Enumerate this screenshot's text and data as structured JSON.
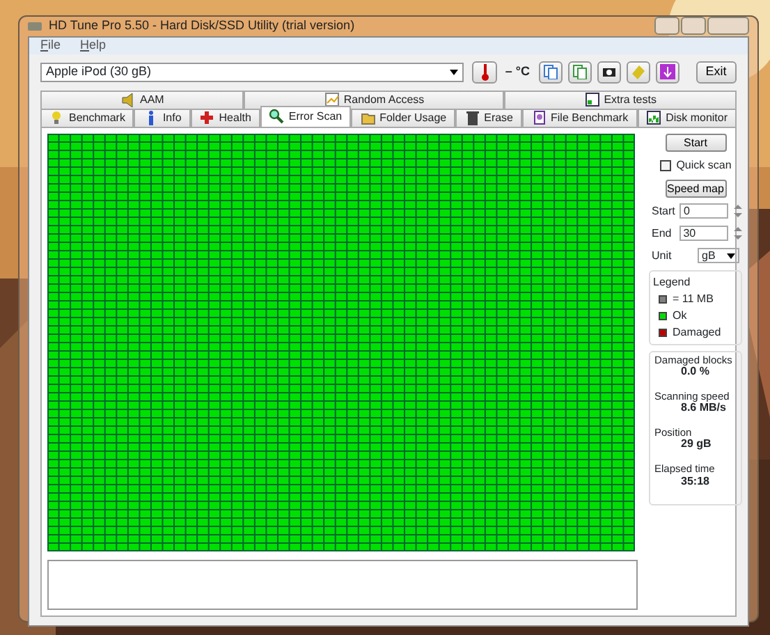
{
  "window": {
    "title": "HD Tune Pro 5.50 - Hard Disk/SSD Utility (trial version)"
  },
  "menu": [
    "File",
    "Help"
  ],
  "toolbar": {
    "device": "Apple  iPod (30 gB)",
    "temperature": "– °C",
    "exit": "Exit"
  },
  "tabs_top": [
    {
      "label": "AAM",
      "selected": false
    },
    {
      "label": "Random Access",
      "selected": false
    },
    {
      "label": "Extra tests",
      "selected": false
    }
  ],
  "tabs": [
    {
      "label": "Benchmark",
      "selected": false
    },
    {
      "label": "Info",
      "selected": false
    },
    {
      "label": "Health",
      "selected": false
    },
    {
      "label": "Error Scan",
      "selected": true
    },
    {
      "label": "Folder Usage",
      "selected": false
    },
    {
      "label": "Erase",
      "selected": false
    },
    {
      "label": "File Benchmark",
      "selected": false
    },
    {
      "label": "Disk monitor",
      "selected": false
    }
  ],
  "side": {
    "start_button": "Start",
    "quick_scan": {
      "label": "Quick scan",
      "checked": false
    },
    "speed_map_button": "Speed map",
    "start": {
      "label": "Start",
      "value": "0"
    },
    "end": {
      "label": "End",
      "value": "30"
    },
    "unit": {
      "label": "Unit",
      "value": "gB"
    }
  },
  "legend": {
    "title": "Legend",
    "items": [
      {
        "label": "= 11 MB",
        "color": "#808080"
      },
      {
        "label": "Ok",
        "color": "#00e000"
      },
      {
        "label": "Damaged",
        "color": "#c00000"
      }
    ]
  },
  "stats": [
    {
      "label": "Damaged blocks",
      "value": "0.0 %"
    },
    {
      "label": "Scanning speed",
      "value": "8.6 MB/s"
    },
    {
      "label": "Position",
      "value": "29 gB"
    },
    {
      "label": "Elapsed time",
      "value": "35:18"
    }
  ]
}
